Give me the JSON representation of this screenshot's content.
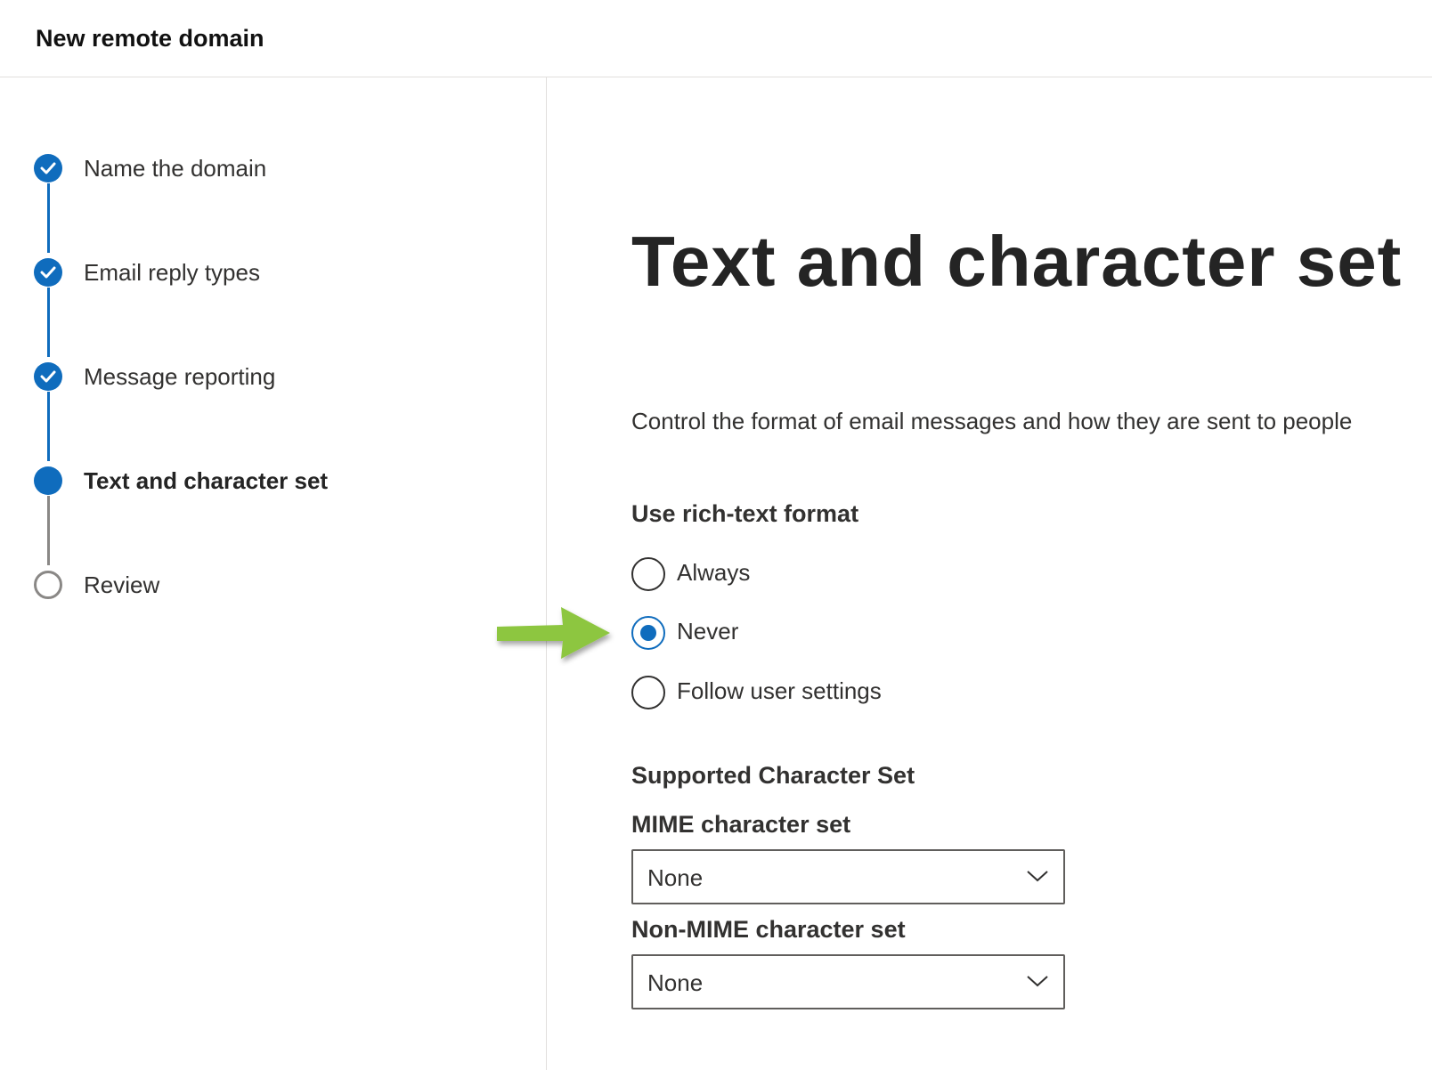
{
  "header": {
    "title": "New remote domain"
  },
  "steps": [
    {
      "label": "Name the domain",
      "status": "done"
    },
    {
      "label": "Email reply types",
      "status": "done"
    },
    {
      "label": "Message reporting",
      "status": "done"
    },
    {
      "label": "Text and character set",
      "status": "current"
    },
    {
      "label": "Review",
      "status": "todo"
    }
  ],
  "main": {
    "title": "Text and character set",
    "description": "Control the format of email messages and how they are sent to people",
    "rich_text": {
      "label": "Use rich-text format",
      "options": [
        "Always",
        "Never",
        "Follow user settings"
      ],
      "selected": "Never"
    },
    "charset": {
      "section_label": "Supported Character Set",
      "mime_label": "MIME character set",
      "mime_value": "None",
      "non_mime_label": "Non-MIME character set",
      "non_mime_value": "None"
    }
  },
  "colors": {
    "accent": "#0f6cbd",
    "annotation_arrow": "#8dc63f"
  },
  "icons": {
    "step_done": "checkmark-icon",
    "dropdown": "chevron-down-icon",
    "annotation": "green-arrow-icon"
  }
}
